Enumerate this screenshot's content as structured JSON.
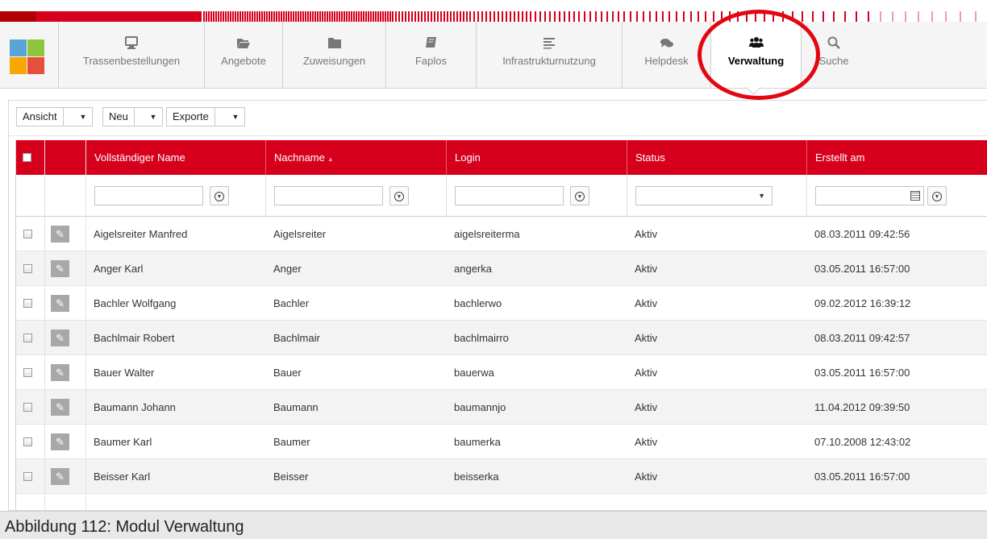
{
  "colors": {
    "accent": "#d6001c",
    "stripe_dark": "#b00000"
  },
  "logo_colors": [
    "#5ba4d8",
    "#8cc63f",
    "#f7a700",
    "#e84e3c"
  ],
  "nav": {
    "tabs": [
      {
        "label": "Trassenbestellungen",
        "icon": "monitor-icon"
      },
      {
        "label": "Angebote",
        "icon": "folder-open-icon"
      },
      {
        "label": "Zuweisungen",
        "icon": "folder-icon"
      },
      {
        "label": "Faplos",
        "icon": "book-icon"
      },
      {
        "label": "Infrastrukturnutzung",
        "icon": "align-left-icon"
      },
      {
        "label": "Helpdesk",
        "icon": "comments-icon"
      },
      {
        "label": "Verwaltung",
        "icon": "users-icon",
        "active": true
      },
      {
        "label": "Suche",
        "icon": "search-icon"
      }
    ]
  },
  "toolbar": {
    "ansicht": "Ansicht",
    "neu": "Neu",
    "exporte": "Exporte"
  },
  "table": {
    "columns": [
      "Vollständiger Name",
      "Nachname",
      "Login",
      "Status",
      "Erstellt am"
    ],
    "sorted_column": "Nachname",
    "rows": [
      {
        "name": "Aigelsreiter Manfred",
        "nachname": "Aigelsreiter",
        "login": "aigelsreiterma",
        "status": "Aktiv",
        "erstellt": "08.03.2011 09:42:56"
      },
      {
        "name": "Anger Karl",
        "nachname": "Anger",
        "login": "angerka",
        "status": "Aktiv",
        "erstellt": "03.05.2011 16:57:00"
      },
      {
        "name": "Bachler Wolfgang",
        "nachname": "Bachler",
        "login": "bachlerwo",
        "status": "Aktiv",
        "erstellt": "09.02.2012 16:39:12"
      },
      {
        "name": "Bachlmair Robert",
        "nachname": "Bachlmair",
        "login": "bachlmairro",
        "status": "Aktiv",
        "erstellt": "08.03.2011 09:42:57"
      },
      {
        "name": "Bauer Walter",
        "nachname": "Bauer",
        "login": "bauerwa",
        "status": "Aktiv",
        "erstellt": "03.05.2011 16:57:00"
      },
      {
        "name": "Baumann Johann",
        "nachname": "Baumann",
        "login": "baumannjo",
        "status": "Aktiv",
        "erstellt": "11.04.2012 09:39:50"
      },
      {
        "name": "Baumer Karl",
        "nachname": "Baumer",
        "login": "baumerka",
        "status": "Aktiv",
        "erstellt": "07.10.2008 12:43:02"
      },
      {
        "name": "Beisser Karl",
        "nachname": "Beisser",
        "login": "beisserka",
        "status": "Aktiv",
        "erstellt": "03.05.2011 16:57:00"
      }
    ]
  },
  "caption": "Abbildung 112: Modul Verwaltung"
}
